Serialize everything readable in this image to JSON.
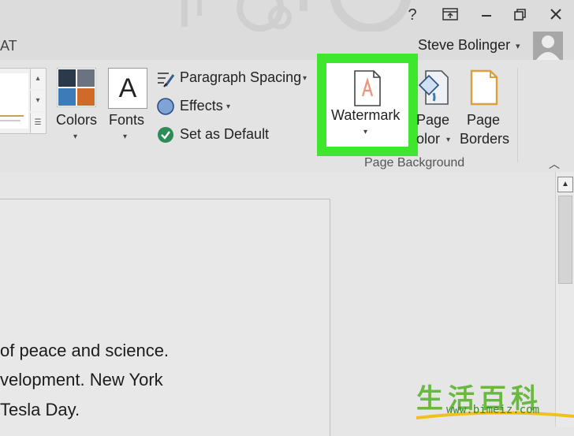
{
  "titlebar": {
    "help_label": "?",
    "buttons": [
      "ribbon-display-options",
      "minimize",
      "restore",
      "close"
    ]
  },
  "tabs": {
    "partial_tab_label": "AT"
  },
  "account": {
    "user_name": "Steve Bolinger",
    "caret": "▾"
  },
  "ribbon": {
    "colors_label": "Colors",
    "fonts_label": "Fonts",
    "fonts_glyph": "A",
    "paragraph_spacing_label": "Paragraph Spacing",
    "effects_label": "Effects",
    "set_default_label": "Set as Default",
    "watermark_label": "Watermark",
    "page_color_label_line1": "Page",
    "page_color_label_line2": "olor",
    "page_borders_label_line1": "Page",
    "page_borders_label_line2": "Borders",
    "group_page_background": "Page Background",
    "caret": "▾",
    "colors": {
      "highlight": "#3ee62e",
      "theme_dark": "#2b3a4a",
      "theme_blue": "#3d7ab8",
      "theme_orange": "#d06a2a",
      "theme_gray": "#6b7280"
    }
  },
  "document": {
    "lines": [
      "of peace and science.",
      "velopment. New York",
      " Tesla Day."
    ]
  },
  "branding": {
    "chars": "生活百科",
    "url": "www.bimeiz.com"
  }
}
